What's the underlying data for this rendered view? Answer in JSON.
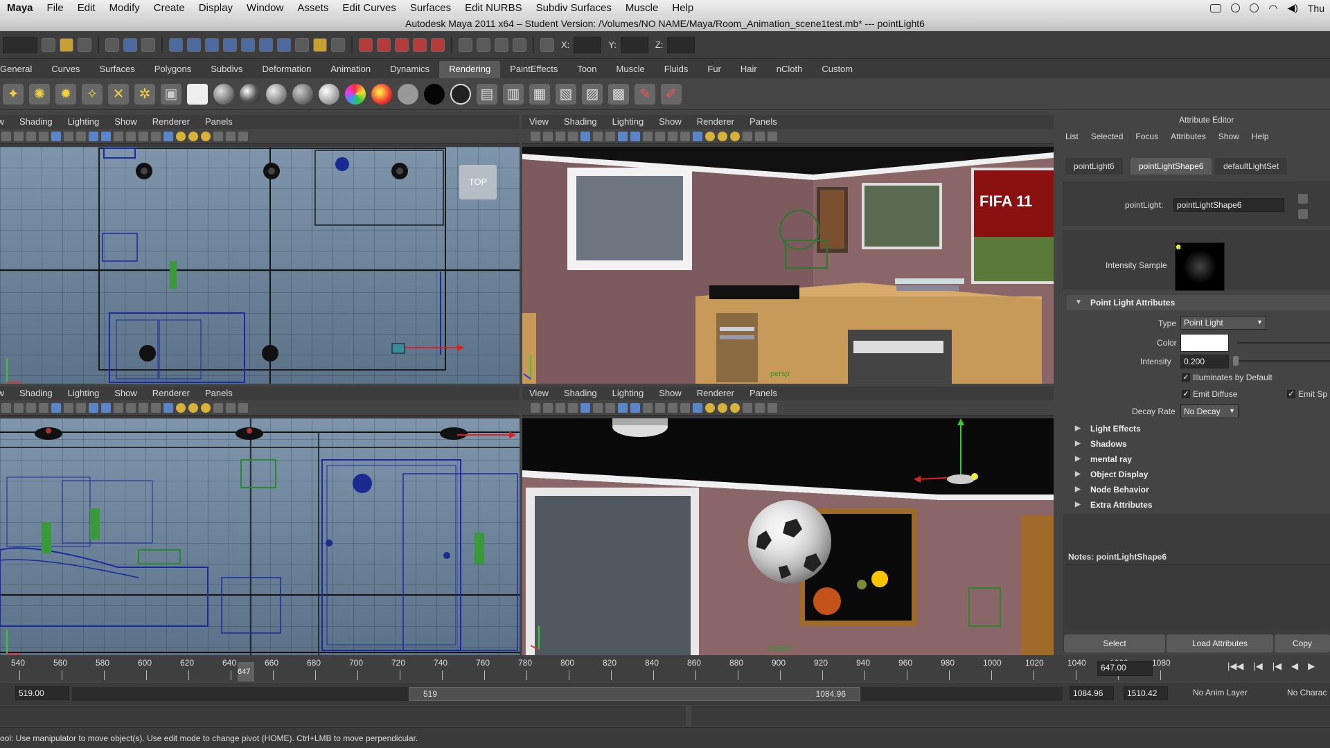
{
  "macbar": {
    "items": [
      "Maya",
      "File",
      "Edit",
      "Modify",
      "Create",
      "Display",
      "Window",
      "Assets",
      "Edit Curves",
      "Surfaces",
      "Edit NURBS",
      "Subdiv Surfaces",
      "Muscle",
      "Help"
    ],
    "clock": "Thu"
  },
  "titlebar": {
    "title": "Autodesk Maya 2011 x64 – Student Version: /Volumes/NO NAME/Maya/Room_Animation_scene1test.mb*  ---  pointLight6"
  },
  "statusline": {
    "x_label": "X:",
    "y_label": "Y:",
    "z_label": "Z:"
  },
  "shelf": {
    "tabs": [
      "General",
      "Curves",
      "Surfaces",
      "Polygons",
      "Subdivs",
      "Deformation",
      "Animation",
      "Dynamics",
      "Rendering",
      "PaintEffects",
      "Toon",
      "Muscle",
      "Fluids",
      "Fur",
      "Hair",
      "nCloth",
      "Custom"
    ],
    "active": "Rendering"
  },
  "panel_menu": [
    "View",
    "Shading",
    "Lighting",
    "Show",
    "Renderer",
    "Panels"
  ],
  "viewports": {
    "top_label": "TOP",
    "persp_label": "persp",
    "scene_label": "scene1",
    "fifa_text": "FIFA 11"
  },
  "attribute_editor": {
    "title": "Attribute Editor",
    "menu": [
      "List",
      "Selected",
      "Focus",
      "Attributes",
      "Show",
      "Help"
    ],
    "tabs": [
      "pointLight6",
      "pointLightShape6",
      "defaultLightSet"
    ],
    "active_tab": "pointLightShape6",
    "node_label": "pointLight:",
    "node_value": "pointLightShape6",
    "intensity_sample_label": "Intensity Sample",
    "point_light_section": "Point Light Attributes",
    "type_label": "Type",
    "type_value": "Point Light",
    "color_label": "Color",
    "color_value": "#ffffff",
    "intensity_label": "Intensity",
    "intensity_value": "0.200",
    "illuminates_label": "Illuminates by Default",
    "emit_diffuse_label": "Emit Diffuse",
    "emit_specular_label": "Emit Sp",
    "decay_label": "Decay Rate",
    "decay_value": "No Decay",
    "sections": [
      "Light Effects",
      "Shadows",
      "mental ray",
      "Object Display",
      "Node Behavior",
      "Extra Attributes"
    ],
    "notes_label": "Notes:  pointLightShape6",
    "buttons": [
      "Select",
      "Load Attributes",
      "Copy"
    ]
  },
  "timeline": {
    "ticks": [
      "540",
      "560",
      "580",
      "600",
      "620",
      "640",
      "660",
      "680",
      "700",
      "720",
      "740",
      "760",
      "780",
      "800",
      "820",
      "840",
      "860",
      "880",
      "900",
      "920",
      "940",
      "960",
      "980",
      "1000",
      "1020",
      "1040",
      "1060",
      "1080"
    ],
    "current_frame_marker": "647",
    "current_frame": "647.00"
  },
  "range": {
    "start": "519.00",
    "slider_start": "519",
    "slider_end": "1084.96",
    "end": "1084.96",
    "max": "1510.42",
    "anim_layer": "No Anim Layer",
    "character": "No Charac"
  },
  "helpline": {
    "text": "ool: Use manipulator to move object(s). Use edit mode to change pivot (HOME). Ctrl+LMB to move perpendicular."
  },
  "colors": {
    "accent_tab": "#5a5a5a",
    "wall": "#8a6668",
    "ortho_bg": "#6d849a"
  }
}
